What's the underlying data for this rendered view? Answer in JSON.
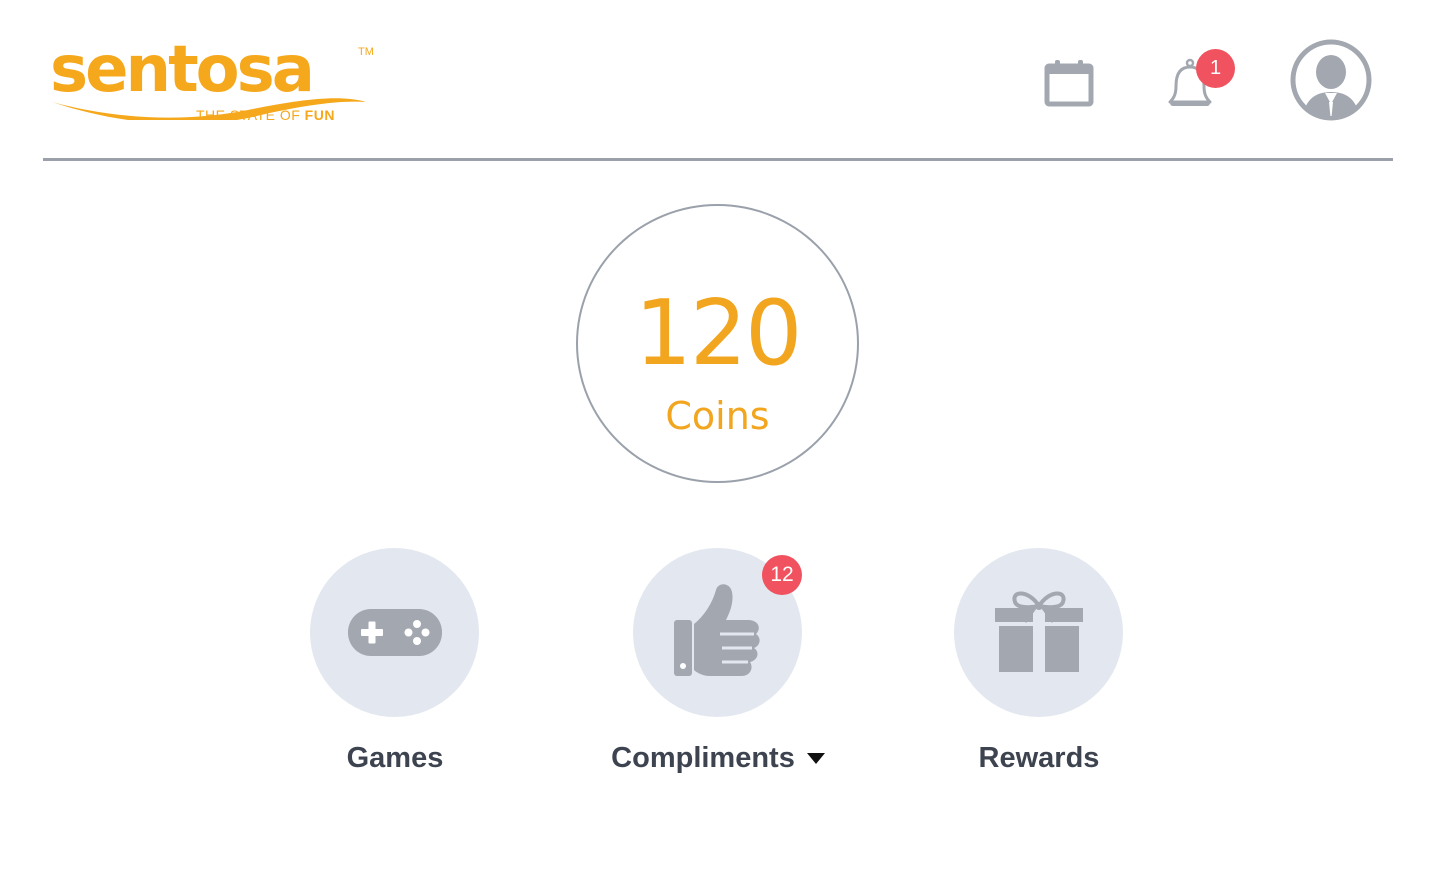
{
  "header": {
    "logo": {
      "wordmark": "sentosa",
      "trademark": "TM",
      "tagline_prefix": "THE STATE OF",
      "tagline_emphasis": "FUN"
    },
    "icons": {
      "calendar": "calendar-icon",
      "notifications": "bell-icon",
      "profile": "user-avatar-icon"
    },
    "notification_count": "1"
  },
  "balance": {
    "value": "120",
    "unit": "Coins"
  },
  "actions": [
    {
      "label": "Games",
      "icon": "gamepad-icon"
    },
    {
      "label": "Compliments",
      "icon": "thumbs-up-icon",
      "badge": "12",
      "has_dropdown": true
    },
    {
      "label": "Rewards",
      "icon": "gift-icon"
    }
  ],
  "colors": {
    "brand_orange": "#f5a81c",
    "badge_red": "#f0525f",
    "icon_gray": "#a3a8b0",
    "circle_bg": "#e3e7ef",
    "label_text": "#3d4450",
    "divider": "#9aa1ab"
  }
}
